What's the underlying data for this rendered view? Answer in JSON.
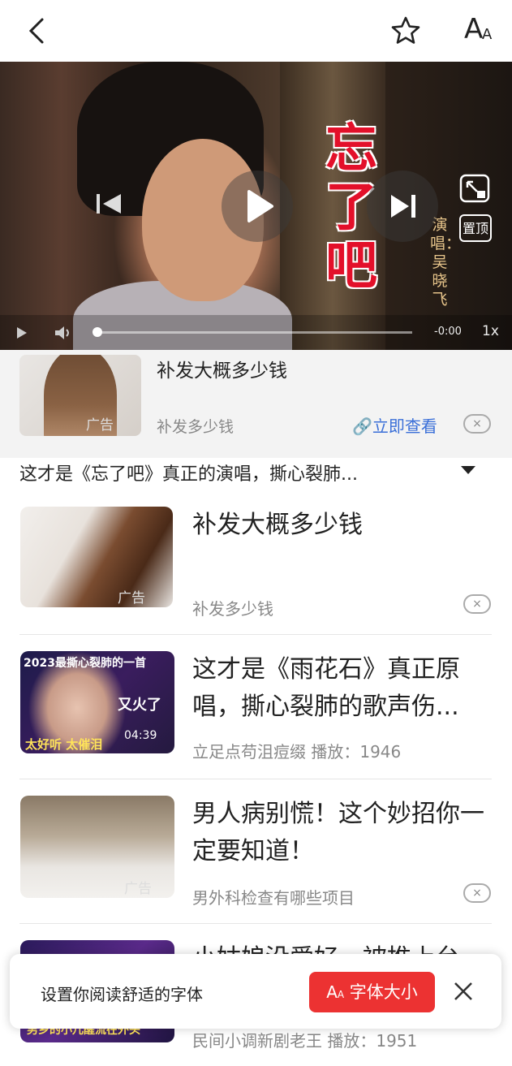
{
  "header": {
    "back_icon": "back-arrow-icon",
    "star_icon": "star-outline-icon",
    "font_icon": "font-size-icon",
    "font_label": "A"
  },
  "video": {
    "song_title_chars": [
      "忘",
      "了",
      "吧"
    ],
    "singer_text": "演唱：吴晓飞",
    "pin_label": "置顶",
    "time": "-0:00",
    "rate": "1x",
    "progress": 0.0
  },
  "top_ad": {
    "title": "补发大概多少钱",
    "source": "补发多少钱",
    "ad_label": "广告",
    "link_label": "立即查看",
    "close_label": "×"
  },
  "video_title": "这才是《忘了吧》真正的演唱，撕心裂肺...",
  "feed": [
    {
      "title": "补发大概多少钱",
      "source": "补发多少钱",
      "ad_label": "广告",
      "close_label": "×"
    },
    {
      "title": "这才是《雨花石》真正原唱，撕心裂肺的歌声伤...",
      "source": "立足点苟沮痘缀  播放：1946",
      "duration": "04:39",
      "thumb_text_top": "2023最撕心裂肺的一首",
      "thumb_text_mid": "又火了",
      "thumb_text_bottom": "太好听 太催泪"
    },
    {
      "title": "男人病别慌！这个妙招你一定要知道！",
      "source": "男外科检查有哪些项目",
      "ad_label": "广告",
      "close_label": "×"
    },
    {
      "title": "小姑娘没爱好，被推上台",
      "source": "民间小调新剧老王  播放：1951",
      "thumb_text_bottom": "男乡的小儿醒流在外头"
    }
  ],
  "toast": {
    "text": "设置你阅读舒适的字体",
    "button_label": "字体大小",
    "button_icon": "A",
    "close_icon": "close-icon"
  },
  "colors": {
    "accent": "#ec3232",
    "link": "#3a6fd8",
    "title_red": "#e3102a"
  }
}
